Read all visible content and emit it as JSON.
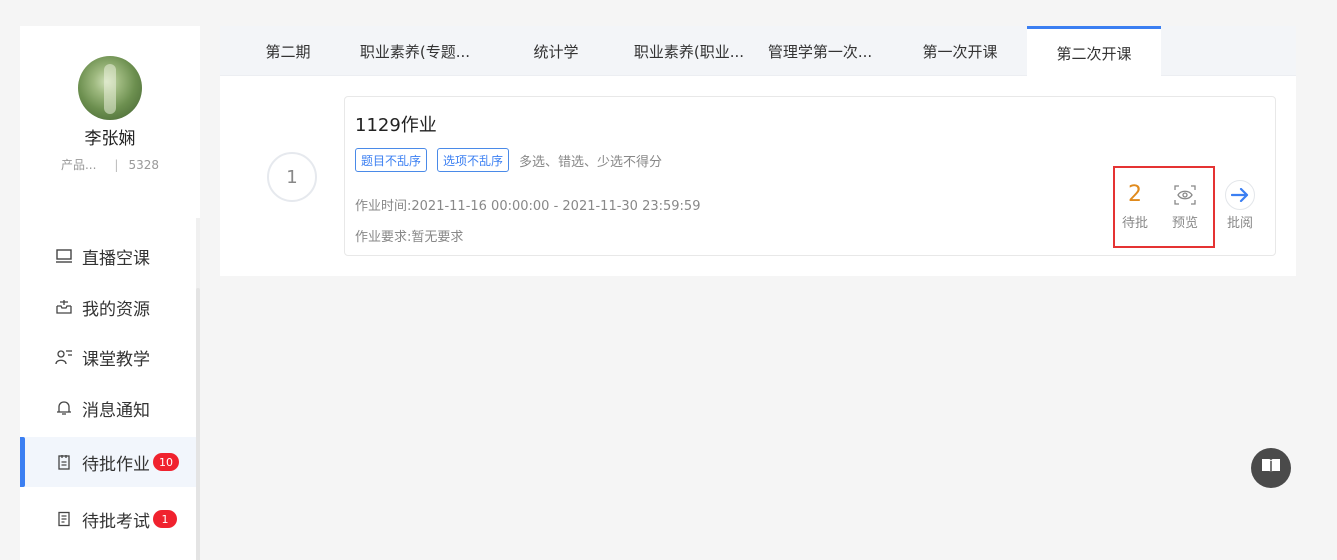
{
  "user": {
    "name": "李张娴",
    "role": "产品...",
    "id": "5328"
  },
  "sidebar": {
    "items": [
      {
        "label": "直播空课",
        "icon": "monitor-icon"
      },
      {
        "label": "我的资源",
        "icon": "inbox-icon"
      },
      {
        "label": "课堂教学",
        "icon": "teacher-icon"
      },
      {
        "label": "消息通知",
        "icon": "bell-icon"
      },
      {
        "label": "待批作业",
        "icon": "notepad-icon",
        "badge": "10",
        "active": true
      },
      {
        "label": "待批考试",
        "icon": "exam-icon",
        "badge": "1"
      }
    ]
  },
  "tabs": [
    {
      "label": "第二期"
    },
    {
      "label": "职业素养(专题..."
    },
    {
      "label": "统计学"
    },
    {
      "label": "职业素养(职业..."
    },
    {
      "label": "管理学第一次..."
    },
    {
      "label": "第一次开课"
    },
    {
      "label": "第二次开课",
      "active": true
    }
  ],
  "assignment": {
    "index": "1",
    "title": "1129作业",
    "tags": [
      "题目不乱序",
      "选项不乱序"
    ],
    "rule": "多选、错选、少选不得分",
    "time": "作业时间:2021-11-16 00:00:00 - 2021-11-30 23:59:59",
    "requirement": "作业要求:暂无要求",
    "pending_count": "2",
    "pending_label": "待批",
    "preview_label": "预览",
    "review_label": "批阅"
  },
  "colors": {
    "accent": "#3b7ff2",
    "badge": "#f0222e",
    "pending": "#e08a1c",
    "highlight": "#e53333"
  }
}
